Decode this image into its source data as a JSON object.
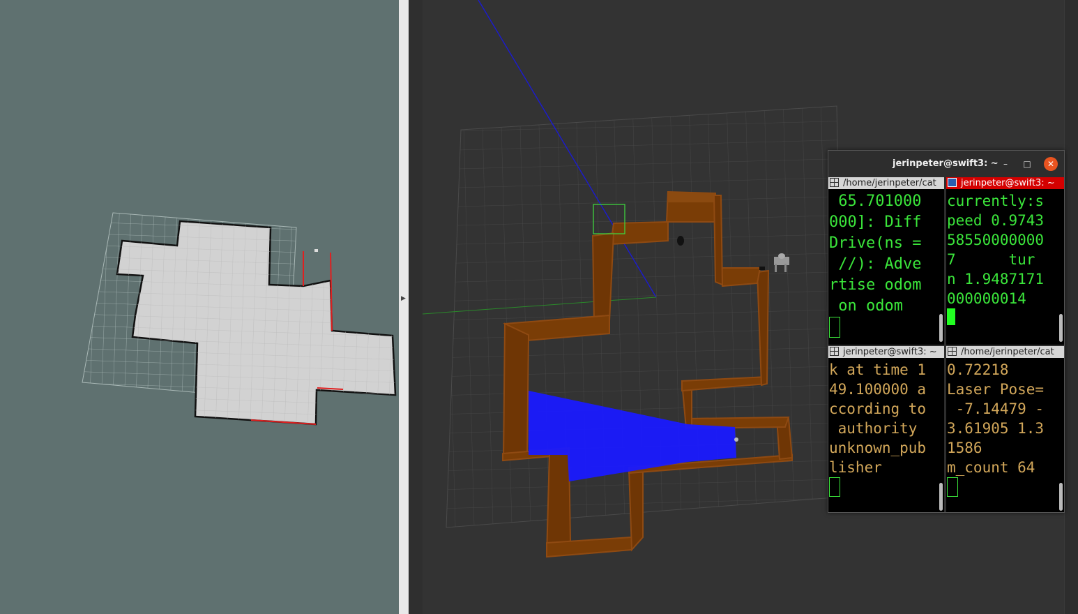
{
  "terminal": {
    "title": "jerinpeter@swift3: ~",
    "buttons": {
      "minimize": "–",
      "maximize": "□",
      "close": "✕"
    },
    "panes": [
      {
        "header": "/home/jerinpeter/cat",
        "lines": [
          " 65.701000",
          "000]: Diff",
          "Drive(ns =",
          " //): Adve",
          "rtise odom",
          " on odom"
        ],
        "active": false
      },
      {
        "header": "jerinpeter@swift3: ~",
        "lines": [
          "currently:s",
          "peed 0.9743",
          "58550000000",
          "7      tur",
          "n 1.9487171",
          "000000014"
        ],
        "active": true
      },
      {
        "header": "jerinpeter@swift3: ~",
        "lines": [
          "k at time 1",
          "49.100000 a",
          "ccording to",
          " authority",
          "unknown_pub",
          "lisher"
        ],
        "active": false
      },
      {
        "header": "/home/jerinpeter/cat",
        "lines": [
          "0.72218",
          "Laser Pose=",
          " -7.14479 -",
          "3.61905 1.3",
          "1586",
          "m_count 64"
        ],
        "active": false
      }
    ]
  },
  "colors": {
    "rviz_bg": "#5f7170",
    "map_free": "#cfcfcf",
    "wall_brown": "#7a3d06",
    "laser_blue": "#1a1aff",
    "terminal_green": "#3be63b",
    "terminal_amber": "#d2a75a"
  }
}
